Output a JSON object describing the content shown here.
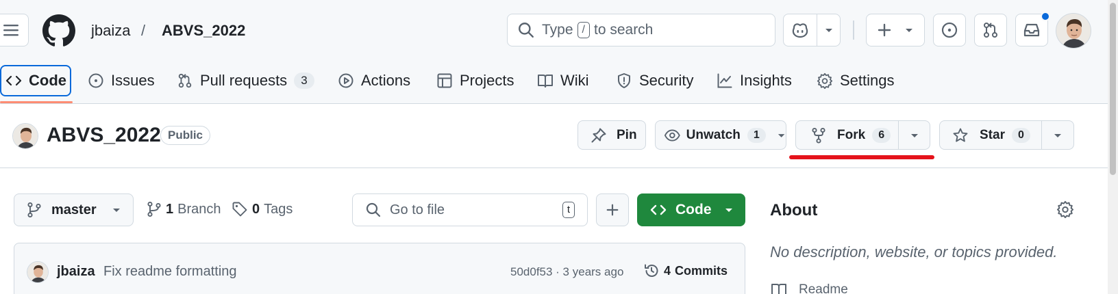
{
  "header": {
    "owner": "jbaiza",
    "separator": "/",
    "repo": "ABVS_2022",
    "search": {
      "prefix": "Type",
      "key": "/",
      "suffix": "to search"
    }
  },
  "tabs": [
    {
      "label": "Code",
      "icon": "code-icon"
    },
    {
      "label": "Issues",
      "icon": "issue-icon"
    },
    {
      "label": "Pull requests",
      "icon": "pull-request-icon",
      "count": "3"
    },
    {
      "label": "Actions",
      "icon": "play-icon"
    },
    {
      "label": "Projects",
      "icon": "table-icon"
    },
    {
      "label": "Wiki",
      "icon": "book-icon"
    },
    {
      "label": "Security",
      "icon": "shield-icon"
    },
    {
      "label": "Insights",
      "icon": "graph-icon"
    },
    {
      "label": "Settings",
      "icon": "gear-icon"
    }
  ],
  "repo_header": {
    "name": "ABVS_2022",
    "visibility": "Public",
    "pin_label": "Pin",
    "unwatch_label": "Unwatch",
    "watch_count": "1",
    "fork_label": "Fork",
    "fork_count": "6",
    "star_label": "Star",
    "star_count": "0"
  },
  "toolbar": {
    "branch": "master",
    "branch_count": "1",
    "branch_label": "Branch",
    "tag_count": "0",
    "tag_label": "Tags",
    "go_to_file_placeholder": "Go to file",
    "go_to_file_key": "t",
    "code_button": "Code"
  },
  "commit": {
    "author": "jbaiza",
    "message": "Fix readme formatting",
    "hash_time": "50d0f53 · 3 years ago",
    "commits_count": "4",
    "commits_label": "Commits"
  },
  "about": {
    "title": "About",
    "description": "No description, website, or topics provided.",
    "readme": "Readme"
  },
  "colors": {
    "accent": "#0969da",
    "primary_green": "#1f883d",
    "annotation_red": "#e5131b",
    "tab_underline": "#fd8c73",
    "notification_dot": "#0969da"
  }
}
